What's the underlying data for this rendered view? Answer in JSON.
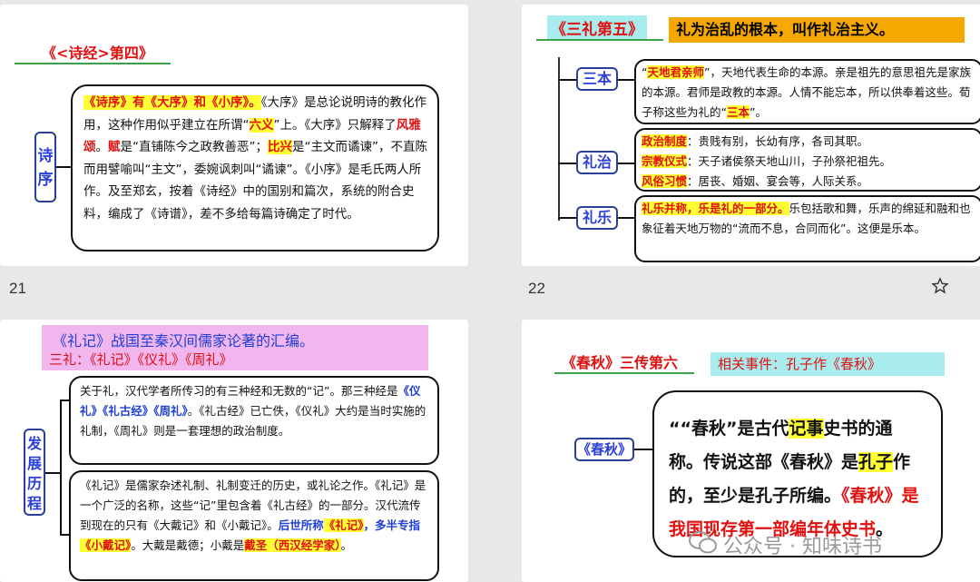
{
  "slides": [
    {
      "number": "21",
      "title": "《<诗经>第四》",
      "label": "诗序",
      "paragraph": {
        "p1_hl": "《诗序》有《大序》和《小序》。",
        "p1": "《大序》是总论说明诗的教化作用，这种作用似乎建立在所谓“",
        "p1_red": "六义",
        "p2": "”上。《大序》只解释了",
        "p2_red": "风雅颂",
        "p3": "。",
        "p3_red": "赋",
        "p4": "是“直铺陈今之政教善恶”；",
        "p4_red": "比兴",
        "p5": "是“主文而谲谏”，不直陈而用譬喻叫“主文”，委婉讽刺叫“谲谏”。《小序》是毛氏两人所作。及至郑玄，按着《诗经》中的国别和篇次，系统的附合史料，编成了《诗谱》，差不多给每篇诗确定了时代。"
      }
    },
    {
      "number": "22",
      "title": "《三礼第五》",
      "banner": "礼为治乱的根本，叫作礼治主义。",
      "nodes": [
        "三本",
        "礼治",
        "礼乐"
      ],
      "sanben": {
        "red": "天地君亲师",
        "t1": "”，天地代表生命的本源。亲是祖先的意思祖先是家族的本源。君师是政教的本源。人情不能忘本，所以供奉着这些。荀子称这些为礼的“",
        "red2": "三本",
        "t2": "”。"
      },
      "lizhi": [
        {
          "k": "政治制度",
          "v": "：贵贱有别，长幼有序，各司其职。"
        },
        {
          "k": "宗教仪式",
          "v": "：天子诸侯祭天地山川，子孙祭祀祖先。"
        },
        {
          "k": "风俗习惯",
          "v": "：居丧、婚姻、宴会等，人际关系。"
        }
      ],
      "liyue": {
        "red": "礼乐并称，乐是礼的一部分。",
        "t": "乐包括歌和舞，乐声的绵延和融和也象征着天地万物的“流而不息，合同而化”。这便是乐本。"
      }
    },
    {
      "title_line1": "《礼记》战国至秦汉间儒家论著的汇编。",
      "title_line2": "三礼：《礼记》《仪礼》《周礼》",
      "label": "发展历程",
      "box1": {
        "t1": "关于礼，汉代学者所传习的有三种经和无数的“记”。那三种经是",
        "b1": "《仪礼》《礼古经》《周礼》",
        "t2": "。《礼古经》已亡佚，《仪礼》大约是当时实施的礼制，《周礼》则是一套理想的政治制度。"
      },
      "box2": {
        "t1": "《礼记》是儒家杂述礼制、礼制变迁的历史，或礼论之作。《礼记》是一个广泛的名称，这些“记”里包含着《礼古经》的一部分。汉代流传到现在的只有《大戴记》和《小戴记》。",
        "b1": "后世所称",
        "r1": "《礼记》",
        "b2": "，多半专指",
        "r2": "《小戴记》",
        "t2": "。大戴是戴德；小戴是",
        "r3": "戴圣（西汉经学家）",
        "t3": "。"
      }
    },
    {
      "title": "《春秋》三传第六",
      "banner": "相关事件：孔子作《春秋》",
      "label": "《春秋》",
      "text": {
        "t1": "“春秋”是古代",
        "hl1": "记事",
        "t2": "史书的通称。传说这部《春秋》是",
        "hl2": "孔子",
        "t3": "作的，至少是孔子所编。",
        "red": "《春秋》是我国现存第一部编年体史书",
        "t4": "。"
      },
      "watermark": "公众号 · 知味诗书"
    }
  ],
  "star_icon": "star-icon"
}
